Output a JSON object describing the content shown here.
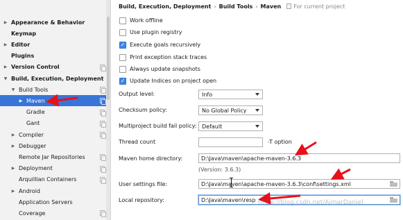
{
  "sidebar": {
    "items": [
      {
        "label": "Appearance & Behavior",
        "bold": true,
        "arrow": "▶",
        "copy": false
      },
      {
        "label": "Keymap",
        "bold": true,
        "arrow": "",
        "copy": false
      },
      {
        "label": "Editor",
        "bold": true,
        "arrow": "▶",
        "copy": false
      },
      {
        "label": "Plugins",
        "bold": true,
        "arrow": "",
        "copy": false
      },
      {
        "label": "Version Control",
        "bold": true,
        "arrow": "▶",
        "copy": true
      },
      {
        "label": "Build, Execution, Deployment",
        "bold": true,
        "arrow": "▼",
        "copy": false
      },
      {
        "label": "Build Tools",
        "bold": false,
        "arrow": "▼",
        "copy": true
      },
      {
        "label": "Maven",
        "bold": false,
        "arrow": "▶",
        "copy": true,
        "selected": true
      },
      {
        "label": "Gradle",
        "bold": false,
        "arrow": "",
        "copy": true
      },
      {
        "label": "Gant",
        "bold": false,
        "arrow": "",
        "copy": true
      },
      {
        "label": "Compiler",
        "bold": false,
        "arrow": "▶",
        "copy": true
      },
      {
        "label": "Debugger",
        "bold": false,
        "arrow": "▶",
        "copy": false
      },
      {
        "label": "Remote Jar Repositories",
        "bold": false,
        "arrow": "",
        "copy": true
      },
      {
        "label": "Deployment",
        "bold": false,
        "arrow": "▶",
        "copy": true
      },
      {
        "label": "Arquillian Containers",
        "bold": false,
        "arrow": "",
        "copy": true
      },
      {
        "label": "Android",
        "bold": false,
        "arrow": "▶",
        "copy": false
      },
      {
        "label": "Application Servers",
        "bold": false,
        "arrow": "",
        "copy": false
      },
      {
        "label": "Coverage",
        "bold": false,
        "arrow": "",
        "copy": true
      }
    ]
  },
  "breadcrumb": {
    "part1": "Build, Execution, Deployment",
    "sep1": "›",
    "part2": "Build Tools",
    "sep2": "›",
    "part3": "Maven",
    "project_note": "For current project"
  },
  "checkboxes": [
    {
      "label": "Work offline",
      "checked": false
    },
    {
      "label": "Use plugin registry",
      "checked": false
    },
    {
      "label": "Execute goals recursively",
      "checked": true
    },
    {
      "label": "Print exception stack traces",
      "checked": false
    },
    {
      "label": "Always update snapshots",
      "checked": false
    },
    {
      "label": "Update Indices on project open",
      "checked": true
    }
  ],
  "check_mark": "✓",
  "form": {
    "output_level_label": "Output level:",
    "output_level_value": "Info",
    "checksum_policy_label": "Checksum policy:",
    "checksum_policy_value": "No Global Policy",
    "fail_policy_label": "Multiproject build fail policy:",
    "fail_policy_value": "Default",
    "thread_count_label": "Thread count",
    "thread_count_value": "",
    "thread_option": "-T option",
    "maven_home_label": "Maven home directory:",
    "maven_home_value": "D:\\Java\\maven\\apache-maven-3.6.3",
    "version_note": "(Version: 3.6.3)",
    "user_settings_label": "User settings file:",
    "user_settings_value": "D:\\Java\\maven\\apache-maven-3.6.3\\conf\\settings.xml",
    "local_repo_label": "Local repository:",
    "local_repo_value": "D:\\Java\\maven\\resp"
  },
  "watermark": "https://blog.csdn.net/AimarDaniel",
  "colors": {
    "selection": "#3875d7",
    "annotation_red": "#e8111b",
    "checkbox_blue": "#3c87ea"
  }
}
